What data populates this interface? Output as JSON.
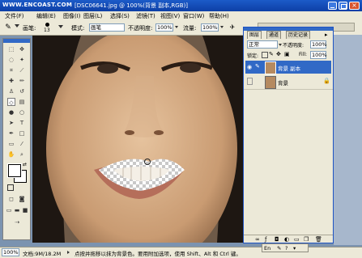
{
  "watermark": "WWW.ENCOAST.COM",
  "title": "[DSC06641.jpg @ 100%(背景 副本,RGB)]",
  "menu": [
    "文件(F)",
    "编辑(E)",
    "图像(I)",
    "图层(L)",
    "选择(S)",
    "滤镜(T)",
    "视图(V)",
    "窗口(W)",
    "帮助(H)"
  ],
  "options": {
    "brush_label": "画笔:",
    "brush_size": "13",
    "mode_label": "模式:",
    "mode_value": "画笔",
    "opacity_label": "不透明度:",
    "opacity_value": "100%",
    "flow_label": "流量:",
    "flow_value": "100%"
  },
  "layers_panel": {
    "tabs": [
      "图层",
      "通道",
      "历史记录"
    ],
    "blend_mode": "正常",
    "opacity_label": "不透明度:",
    "opacity_value": "100%",
    "lock_label": "锁定:",
    "fill_label": "Fill:",
    "fill_value": "100%",
    "layers": [
      {
        "name": "背景 副本",
        "selected": true,
        "visible": true
      },
      {
        "name": "背景",
        "selected": false,
        "visible": false
      }
    ]
  },
  "status": {
    "zoom": "100%",
    "doc": "文档:9M/18.2M",
    "hint": "点按并拖移以抹为背景色。要用附加选项，使用 Shift、Alt 和 Ctrl 键。"
  },
  "ime": {
    "label": "En"
  },
  "colors": {
    "title_bar": "#1c5bc8",
    "selection": "#3169c6",
    "panel": "#ece9d8"
  }
}
